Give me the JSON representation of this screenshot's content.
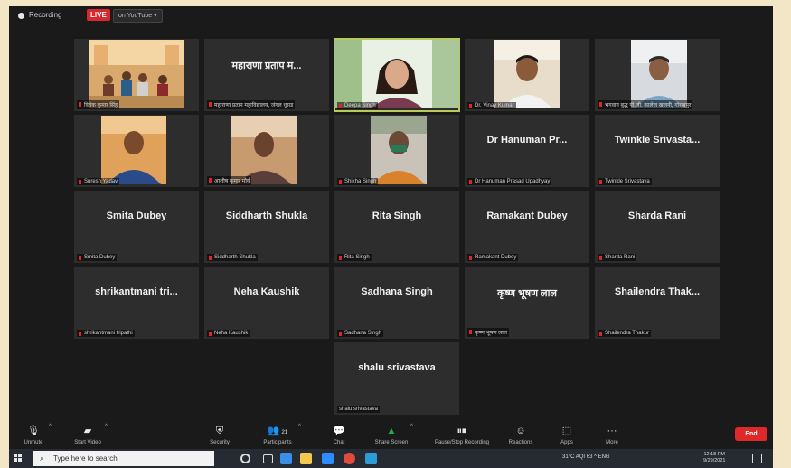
{
  "topbar": {
    "recording": "Recording",
    "live": "LIVE",
    "stream": "on YouTube"
  },
  "tiles": [
    {
      "big": "",
      "name": "विवेक कुमार सिंह"
    },
    {
      "big": "महाराणा प्रताप म...",
      "name": "महाराणा प्रताप महाविद्यालय, जंगल धूसड"
    },
    {
      "big": "",
      "name": "Deepa Singh"
    },
    {
      "big": "",
      "name": "Dr. Vinay Kumar"
    },
    {
      "big": "",
      "name": "भगवान बुद्ध पी.जी. कालेज खजनी, गोरखपुर"
    },
    {
      "big": "",
      "name": "Suresh Yadav"
    },
    {
      "big": "",
      "name": "आशीष कुमार मौर्य"
    },
    {
      "big": "",
      "name": "Shikha Singh"
    },
    {
      "big": "Dr Hanuman Pr...",
      "name": "Dr Hanuman Prasad Upadhyay"
    },
    {
      "big": "Twinkle  Srivasta...",
      "name": "Twinkle Srivastava"
    },
    {
      "big": "Smita Dubey",
      "name": "Smita Dubey"
    },
    {
      "big": "Siddharth Shukla",
      "name": "Siddharth Shukla"
    },
    {
      "big": "Rita Singh",
      "name": "Rita Singh"
    },
    {
      "big": "Ramakant Dubey",
      "name": "Ramakant Dubey"
    },
    {
      "big": "Sharda Rani",
      "name": "Sharda Rani"
    },
    {
      "big": "shrikantmani  tri...",
      "name": "shrikantmani tripathi"
    },
    {
      "big": "Neha Kaushik",
      "name": "Neha Kaushik"
    },
    {
      "big": "Sadhana Singh",
      "name": "Sadhana Singh"
    },
    {
      "big": "कृष्ण भूषण लाल",
      "name": "कृष्ण भूषण लाल"
    },
    {
      "big": "Shailendra  Thak...",
      "name": "Shailendra Thakur"
    },
    {
      "big": "shalu srivastava",
      "name": "shalu srivastava"
    }
  ],
  "toolbar": {
    "unmute": "Unmute",
    "start_video": "Start Video",
    "security": "Security",
    "participants": "Participants",
    "participants_count": "21",
    "chat": "Chat",
    "share_screen": "Share Screen",
    "pause_stop_recording": "Pause/Stop Recording",
    "reactions": "Reactions",
    "apps": "Apps",
    "more": "More",
    "end": "End"
  },
  "taskbar": {
    "search_placeholder": "Type here to search",
    "tray_text": "31°C  AQI 63   ^   ENG",
    "time": "12:18 PM",
    "date": "9/29/2021"
  },
  "colors": {
    "accent_red": "#d9272e",
    "share_green": "#22b04a",
    "active_border": "#b9c95a"
  }
}
